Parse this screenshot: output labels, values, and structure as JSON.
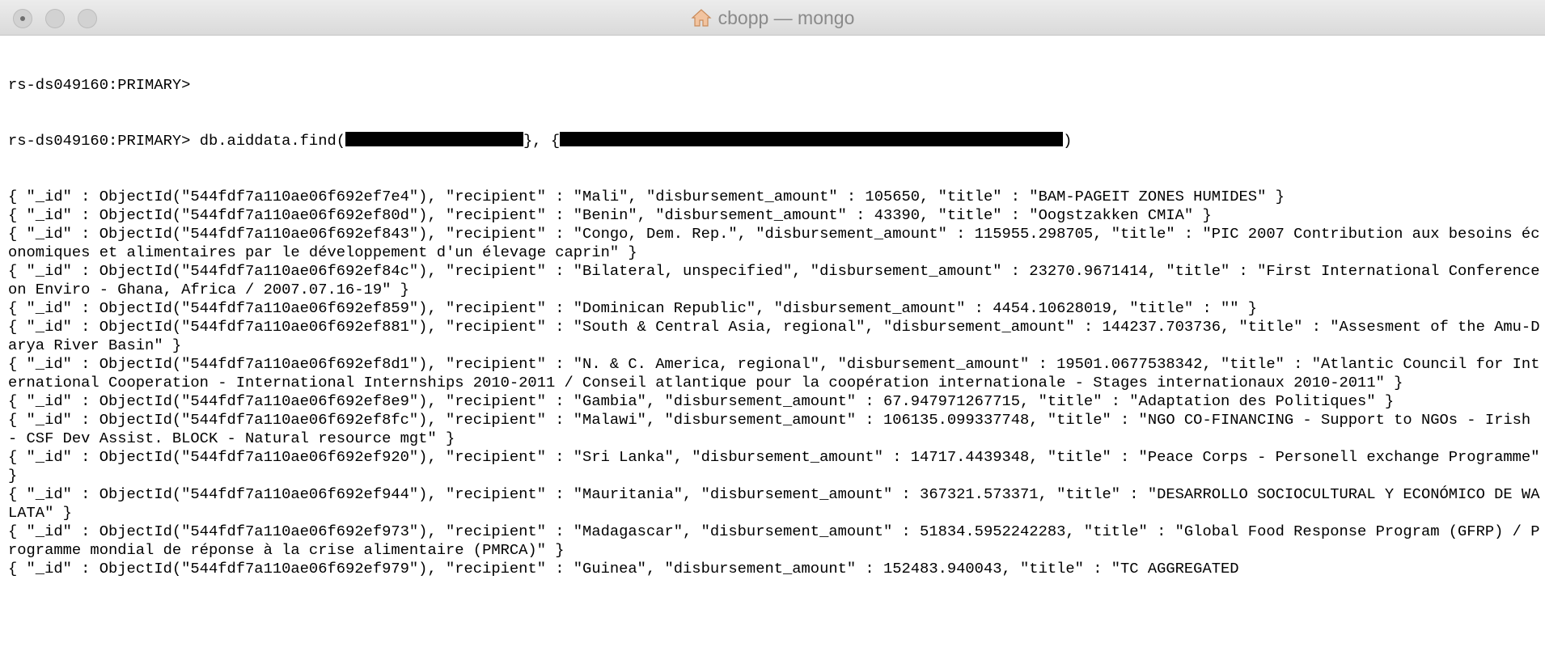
{
  "window": {
    "title": "cbopp — mongo",
    "icons": [
      "close-button",
      "minimize-button",
      "maximize-button",
      "home-icon"
    ]
  },
  "terminal": {
    "prompt_line": "rs-ds049160:PRIMARY>",
    "command": {
      "prompt": "rs-ds049160:PRIMARY> ",
      "command_start": "db.aiddata.find(",
      "between_redactions": "}, {",
      "command_end": ")"
    },
    "output": [
      "{ \"_id\" : ObjectId(\"544fdf7a110ae06f692ef7e4\"), \"recipient\" : \"Mali\", \"disbursement_amount\" : 105650, \"title\" : \"BAM-PAGEIT ZONES HUMIDES\" }",
      "{ \"_id\" : ObjectId(\"544fdf7a110ae06f692ef80d\"), \"recipient\" : \"Benin\", \"disbursement_amount\" : 43390, \"title\" : \"Oogstzakken CMIA\" }",
      "{ \"_id\" : ObjectId(\"544fdf7a110ae06f692ef843\"), \"recipient\" : \"Congo, Dem. Rep.\", \"disbursement_amount\" : 115955.298705, \"title\" : \"PIC 2007 Contribution aux besoins économiques et alimentaires par le développement d'un élevage caprin\" }",
      "{ \"_id\" : ObjectId(\"544fdf7a110ae06f692ef84c\"), \"recipient\" : \"Bilateral, unspecified\", \"disbursement_amount\" : 23270.9671414, \"title\" : \"First International Conference on Enviro - Ghana, Africa / 2007.07.16-19\" }",
      "{ \"_id\" : ObjectId(\"544fdf7a110ae06f692ef859\"), \"recipient\" : \"Dominican Republic\", \"disbursement_amount\" : 4454.10628019, \"title\" : \"\" }",
      "{ \"_id\" : ObjectId(\"544fdf7a110ae06f692ef881\"), \"recipient\" : \"South & Central Asia, regional\", \"disbursement_amount\" : 144237.703736, \"title\" : \"Assesment of the Amu-Darya River Basin\" }",
      "{ \"_id\" : ObjectId(\"544fdf7a110ae06f692ef8d1\"), \"recipient\" : \"N. & C. America, regional\", \"disbursement_amount\" : 19501.0677538342, \"title\" : \"Atlantic Council for International Cooperation - International Internships 2010-2011 / Conseil atlantique pour la coopération internationale - Stages internationaux 2010-2011\" }",
      "{ \"_id\" : ObjectId(\"544fdf7a110ae06f692ef8e9\"), \"recipient\" : \"Gambia\", \"disbursement_amount\" : 67.947971267715, \"title\" : \"Adaptation des Politiques\" }",
      "{ \"_id\" : ObjectId(\"544fdf7a110ae06f692ef8fc\"), \"recipient\" : \"Malawi\", \"disbursement_amount\" : 106135.099337748, \"title\" : \"NGO CO-FINANCING - Support to NGOs - Irish - CSF Dev Assist. BLOCK - Natural resource mgt\" }",
      "{ \"_id\" : ObjectId(\"544fdf7a110ae06f692ef920\"), \"recipient\" : \"Sri Lanka\", \"disbursement_amount\" : 14717.4439348, \"title\" : \"Peace Corps - Personell exchange Programme\" }",
      "{ \"_id\" : ObjectId(\"544fdf7a110ae06f692ef944\"), \"recipient\" : \"Mauritania\", \"disbursement_amount\" : 367321.573371, \"title\" : \"DESARROLLO SOCIOCULTURAL Y ECONÓMICO DE WALATA\" }",
      "{ \"_id\" : ObjectId(\"544fdf7a110ae06f692ef973\"), \"recipient\" : \"Madagascar\", \"disbursement_amount\" : 51834.5952242283, \"title\" : \"Global Food Response Program (GFRP) / Programme mondial de réponse à la crise alimentaire (PMRCA)\" }",
      "{ \"_id\" : ObjectId(\"544fdf7a110ae06f692ef979\"), \"recipient\" : \"Guinea\", \"disbursement_amount\" : 152483.940043, \"title\" : \"TC AGGREGATED"
    ]
  }
}
